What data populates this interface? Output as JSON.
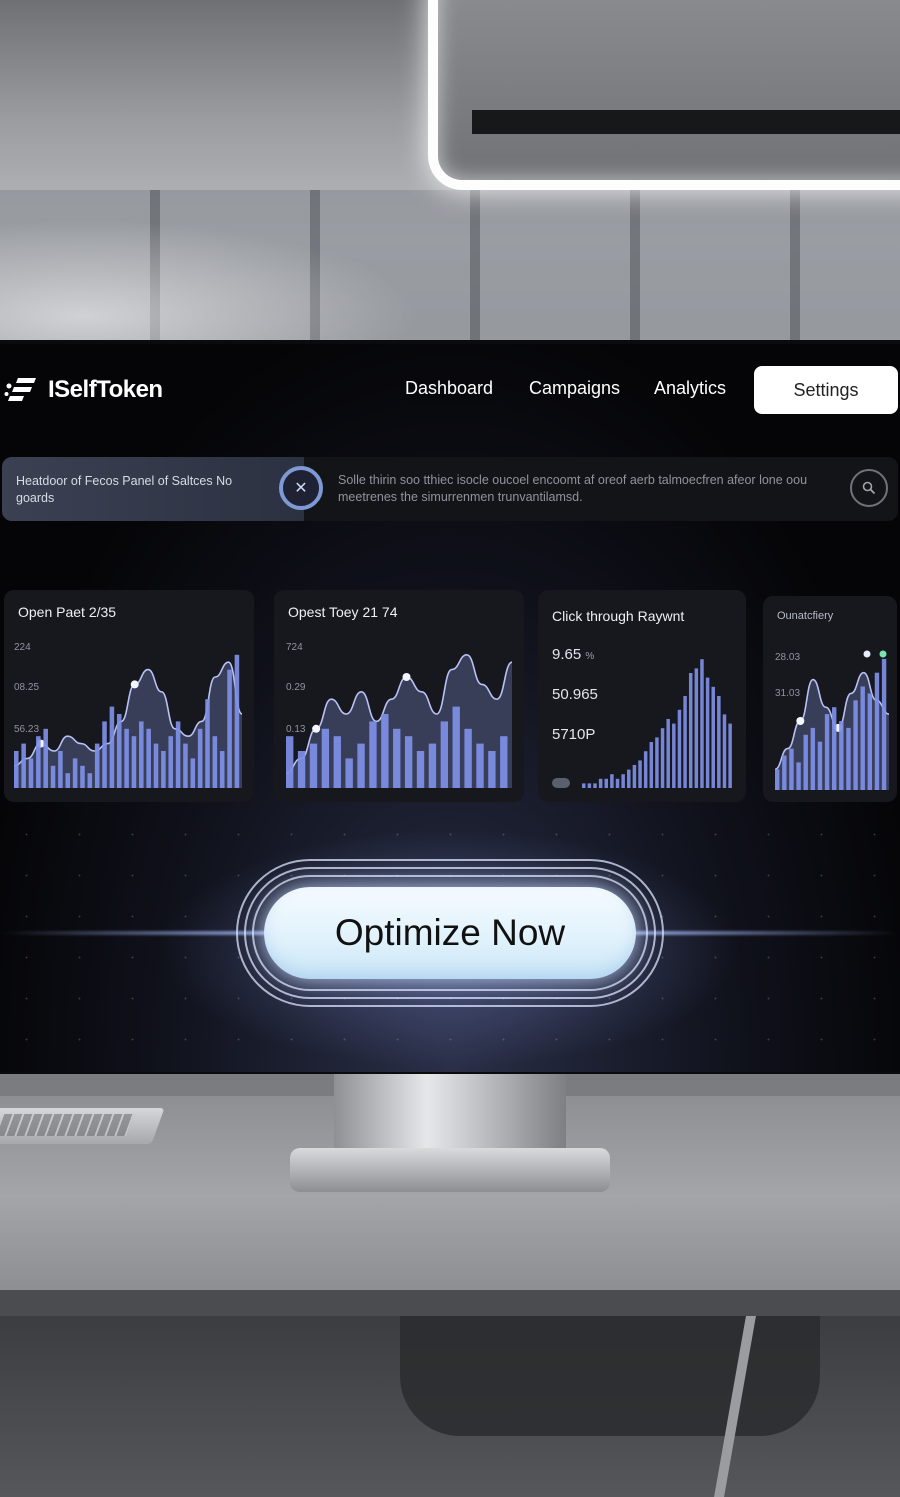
{
  "app": {
    "name": "ISelfToken"
  },
  "nav": {
    "items": [
      "Dashboard",
      "Campaigns",
      "Analytics"
    ],
    "settings": "Settings"
  },
  "info_bar": {
    "left_text": "Heatdoor of Fecos Panel of Saltces No goards",
    "right_text": "Solle thirin soo tthiec isocle oucoel encoomt af oreof aerb talmoecfren afeor lone oou meetrenes the simurrenmen trunvantilamsd.",
    "close_icon": "close-icon",
    "search_icon": "search-icon"
  },
  "cards": [
    {
      "title": "Open Paet 2/35",
      "ticks": [
        "224",
        "08.25",
        "56.23"
      ]
    },
    {
      "title": "Opest Toey 21 74",
      "ticks": [
        "724",
        "0.29",
        "0.13"
      ]
    },
    {
      "title": "Click through Raywnt",
      "stats": [
        "9.65",
        "50.965",
        "5710P"
      ],
      "stat_suffix": "%"
    },
    {
      "title": "Ounatcfiery",
      "ticks": [
        "28.03",
        "31.03"
      ]
    }
  ],
  "chart_data": [
    {
      "type": "bar",
      "title": "Open Paet 2/35",
      "values": [
        5,
        6,
        4,
        7,
        8,
        3,
        5,
        2,
        4,
        3,
        2,
        6,
        9,
        11,
        10,
        8,
        7,
        9,
        8,
        6,
        5,
        7,
        9,
        6,
        4,
        8,
        12,
        7,
        5,
        16,
        18
      ],
      "line": [
        3,
        4,
        6,
        5,
        7,
        6,
        5,
        6,
        9,
        14,
        16,
        13,
        8,
        7,
        9,
        15,
        17,
        10
      ],
      "ylim": [
        0,
        20
      ]
    },
    {
      "type": "bar",
      "title": "Opest Toey 21 74",
      "values": [
        7,
        5,
        6,
        8,
        7,
        4,
        6,
        9,
        10,
        8,
        7,
        5,
        6,
        9,
        11,
        8,
        6,
        5,
        7
      ],
      "line": [
        2,
        4,
        8,
        12,
        10,
        13,
        9,
        12,
        15,
        13,
        10,
        16,
        18,
        14,
        12,
        17
      ],
      "ylim": [
        0,
        20
      ]
    },
    {
      "type": "bar",
      "title": "Click through Raywnt",
      "values": [
        1,
        1,
        1,
        2,
        2,
        3,
        2,
        3,
        4,
        5,
        6,
        8,
        10,
        11,
        13,
        15,
        14,
        17,
        20,
        25,
        26,
        28,
        24,
        22,
        20,
        16,
        14
      ],
      "ylim": [
        0,
        30
      ]
    },
    {
      "type": "bar",
      "title": "Ounatcfiery",
      "values": [
        3,
        5,
        6,
        4,
        8,
        9,
        7,
        11,
        12,
        10,
        9,
        13,
        15,
        14,
        17,
        19
      ],
      "line": [
        3,
        6,
        10,
        16,
        12,
        9,
        14,
        17,
        13,
        11
      ],
      "ylim": [
        0,
        20
      ]
    }
  ],
  "cta": {
    "label": "Optimize Now"
  },
  "colors": {
    "accent": "#8b9bf2",
    "bar": "#7f8fe6",
    "background": "#050507"
  }
}
